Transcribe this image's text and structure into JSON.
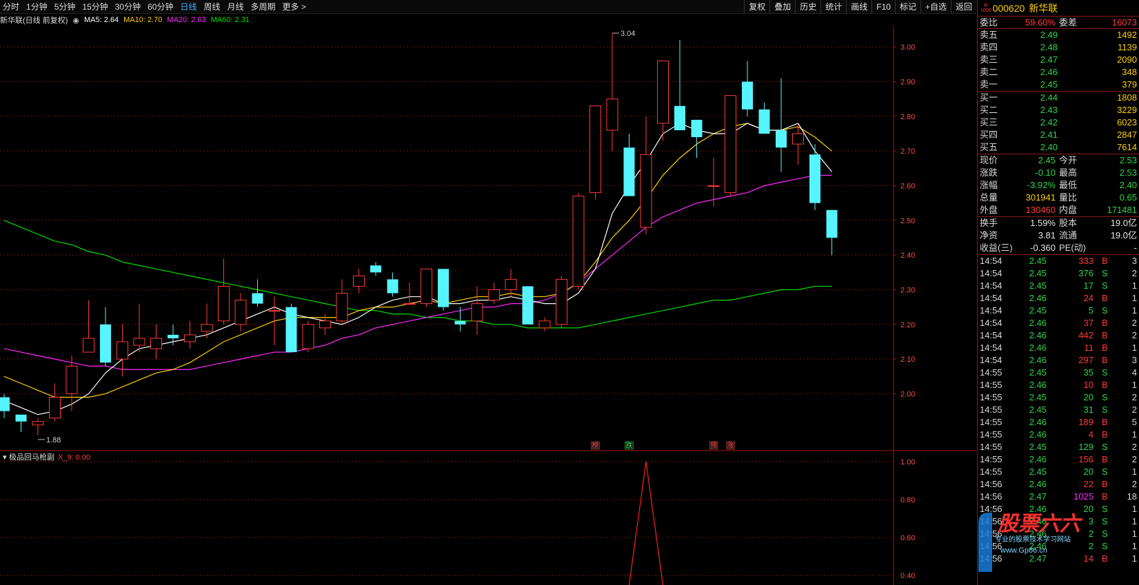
{
  "periods": [
    {
      "label": "分时",
      "active": false
    },
    {
      "label": "1分钟",
      "active": false
    },
    {
      "label": "5分钟",
      "active": false
    },
    {
      "label": "15分钟",
      "active": false
    },
    {
      "label": "30分钟",
      "active": false
    },
    {
      "label": "60分钟",
      "active": false
    },
    {
      "label": "日线",
      "active": true
    },
    {
      "label": "周线",
      "active": false
    },
    {
      "label": "月线",
      "active": false
    },
    {
      "label": "多周期",
      "active": false
    },
    {
      "label": "更多 >",
      "active": false
    }
  ],
  "tools": [
    "复权",
    "叠加",
    "历史",
    "统计",
    "画线",
    "F10",
    "标记",
    "+自选",
    "返回"
  ],
  "info": {
    "title": "新华联(日线 前复权)",
    "ma": [
      {
        "label": "MA5: 2.64",
        "color": "#ffffff"
      },
      {
        "label": "MA10: 2.70",
        "color": "#ffd000"
      },
      {
        "label": "MA20: 2.63",
        "color": "#ff2bff"
      },
      {
        "label": "MA60: 2.31",
        "color": "#00e000"
      }
    ]
  },
  "indicator": {
    "name": "极品回马枪副",
    "value": "X_9: 0.00"
  },
  "colors": {
    "up": "#ff3b3b",
    "down": "#55f4ff",
    "ma5": "#ffffff",
    "ma10": "#ffd000",
    "ma20": "#ff2bff",
    "ma60": "#00e000"
  },
  "chart_data": {
    "type": "candlestick",
    "price_axis": {
      "min": 1.84,
      "max": 3.06,
      "ticks": [
        "3.00",
        "2.90",
        "2.80",
        "2.70",
        "2.60",
        "2.50",
        "2.40",
        "2.30",
        "2.20",
        "2.10",
        "2.00"
      ]
    },
    "annotations": {
      "high": "3.04",
      "low": "1.88"
    },
    "candles": [
      {
        "o": 1.99,
        "c": 1.95,
        "h": 2.0,
        "l": 1.93
      },
      {
        "o": 1.94,
        "c": 1.92,
        "h": 1.94,
        "l": 1.89
      },
      {
        "o": 1.91,
        "c": 1.92,
        "h": 1.93,
        "l": 1.88
      },
      {
        "o": 1.93,
        "c": 1.99,
        "h": 2.03,
        "l": 1.92
      },
      {
        "o": 2.0,
        "c": 2.08,
        "h": 2.11,
        "l": 1.95
      },
      {
        "o": 2.12,
        "c": 2.16,
        "h": 2.27,
        "l": 2.12
      },
      {
        "o": 2.2,
        "c": 2.09,
        "h": 2.25,
        "l": 2.08
      },
      {
        "o": 2.1,
        "c": 2.15,
        "h": 2.2,
        "l": 2.05
      },
      {
        "o": 2.14,
        "c": 2.16,
        "h": 2.26,
        "l": 2.12
      },
      {
        "o": 2.13,
        "c": 2.16,
        "h": 2.2,
        "l": 2.1
      },
      {
        "o": 2.17,
        "c": 2.16,
        "h": 2.2,
        "l": 2.14
      },
      {
        "o": 2.15,
        "c": 2.17,
        "h": 2.21,
        "l": 2.13
      },
      {
        "o": 2.18,
        "c": 2.2,
        "h": 2.26,
        "l": 2.16
      },
      {
        "o": 2.21,
        "c": 2.31,
        "h": 2.39,
        "l": 2.2
      },
      {
        "o": 2.2,
        "c": 2.27,
        "h": 2.29,
        "l": 2.18
      },
      {
        "o": 2.29,
        "c": 2.26,
        "h": 2.33,
        "l": 2.25
      },
      {
        "o": 2.24,
        "c": 2.24,
        "h": 2.28,
        "l": 2.14
      },
      {
        "o": 2.25,
        "c": 2.12,
        "h": 2.26,
        "l": 2.12
      },
      {
        "o": 2.13,
        "c": 2.2,
        "h": 2.21,
        "l": 2.12
      },
      {
        "o": 2.19,
        "c": 2.21,
        "h": 2.23,
        "l": 2.17
      },
      {
        "o": 2.21,
        "c": 2.29,
        "h": 2.33,
        "l": 2.2
      },
      {
        "o": 2.31,
        "c": 2.34,
        "h": 2.36,
        "l": 2.29
      },
      {
        "o": 2.37,
        "c": 2.35,
        "h": 2.38,
        "l": 2.34
      },
      {
        "o": 2.33,
        "c": 2.29,
        "h": 2.35,
        "l": 2.28
      },
      {
        "o": 2.26,
        "c": 2.26,
        "h": 2.32,
        "l": 2.26
      },
      {
        "o": 2.26,
        "c": 2.36,
        "h": 2.36,
        "l": 2.25
      },
      {
        "o": 2.36,
        "c": 2.25,
        "h": 2.36,
        "l": 2.24
      },
      {
        "o": 2.21,
        "c": 2.2,
        "h": 2.25,
        "l": 2.18
      },
      {
        "o": 2.21,
        "c": 2.26,
        "h": 2.31,
        "l": 2.17
      },
      {
        "o": 2.27,
        "c": 2.3,
        "h": 2.32,
        "l": 2.26
      },
      {
        "o": 2.3,
        "c": 2.33,
        "h": 2.36,
        "l": 2.28
      },
      {
        "o": 2.31,
        "c": 2.2,
        "h": 2.31,
        "l": 2.2
      },
      {
        "o": 2.19,
        "c": 2.21,
        "h": 2.22,
        "l": 2.18
      },
      {
        "o": 2.2,
        "c": 2.33,
        "h": 2.34,
        "l": 2.19
      },
      {
        "o": 2.31,
        "c": 2.57,
        "h": 2.58,
        "l": 2.3
      },
      {
        "o": 2.58,
        "c": 2.83,
        "h": 2.83,
        "l": 2.56
      },
      {
        "o": 2.76,
        "c": 2.85,
        "h": 3.04,
        "l": 2.7
      },
      {
        "o": 2.71,
        "c": 2.57,
        "h": 2.75,
        "l": 2.57
      },
      {
        "o": 2.48,
        "c": 2.69,
        "h": 2.8,
        "l": 2.46
      },
      {
        "o": 2.78,
        "c": 2.96,
        "h": 2.96,
        "l": 2.73
      },
      {
        "o": 2.83,
        "c": 2.76,
        "h": 3.02,
        "l": 2.76
      },
      {
        "o": 2.79,
        "c": 2.74,
        "h": 2.79,
        "l": 2.68
      },
      {
        "o": 2.6,
        "c": 2.6,
        "h": 2.68,
        "l": 2.54
      },
      {
        "o": 2.58,
        "c": 2.86,
        "h": 2.86,
        "l": 2.57
      },
      {
        "o": 2.9,
        "c": 2.82,
        "h": 2.96,
        "l": 2.8
      },
      {
        "o": 2.82,
        "c": 2.75,
        "h": 2.84,
        "l": 2.75
      },
      {
        "o": 2.76,
        "c": 2.71,
        "h": 2.91,
        "l": 2.64
      },
      {
        "o": 2.72,
        "c": 2.75,
        "h": 2.78,
        "l": 2.66
      },
      {
        "o": 2.69,
        "c": 2.55,
        "h": 2.72,
        "l": 2.53
      },
      {
        "o": 2.53,
        "c": 2.45,
        "h": 2.53,
        "l": 2.4
      }
    ],
    "ma5": [
      1.98,
      1.96,
      1.94,
      1.95,
      1.97,
      2.0,
      2.06,
      2.1,
      2.13,
      2.14,
      2.15,
      2.16,
      2.17,
      2.19,
      2.21,
      2.23,
      2.25,
      2.23,
      2.22,
      2.21,
      2.2,
      2.22,
      2.25,
      2.27,
      2.28,
      2.28,
      2.26,
      2.26,
      2.27,
      2.27,
      2.28,
      2.27,
      2.26,
      2.26,
      2.29,
      2.36,
      2.52,
      2.6,
      2.67,
      2.75,
      2.78,
      2.76,
      2.75,
      2.75,
      2.78,
      2.76,
      2.76,
      2.78,
      2.7,
      2.64
    ],
    "ma10": [
      2.05,
      2.03,
      2.01,
      1.99,
      1.99,
      1.99,
      2.0,
      2.02,
      2.04,
      2.06,
      2.07,
      2.09,
      2.12,
      2.15,
      2.17,
      2.19,
      2.21,
      2.22,
      2.22,
      2.22,
      2.22,
      2.24,
      2.25,
      2.25,
      2.26,
      2.27,
      2.26,
      2.27,
      2.28,
      2.28,
      2.29,
      2.28,
      2.28,
      2.29,
      2.32,
      2.38,
      2.45,
      2.5,
      2.56,
      2.63,
      2.68,
      2.72,
      2.75,
      2.77,
      2.78,
      2.76,
      2.76,
      2.77,
      2.74,
      2.7
    ],
    "ma20": [
      2.13,
      2.12,
      2.11,
      2.1,
      2.09,
      2.08,
      2.08,
      2.07,
      2.07,
      2.07,
      2.07,
      2.07,
      2.08,
      2.09,
      2.1,
      2.11,
      2.12,
      2.12,
      2.13,
      2.14,
      2.16,
      2.17,
      2.19,
      2.2,
      2.21,
      2.22,
      2.23,
      2.24,
      2.25,
      2.25,
      2.26,
      2.26,
      2.27,
      2.29,
      2.32,
      2.36,
      2.4,
      2.44,
      2.48,
      2.51,
      2.53,
      2.55,
      2.56,
      2.57,
      2.58,
      2.6,
      2.61,
      2.62,
      2.63,
      2.63
    ],
    "ma60": [
      2.5,
      2.48,
      2.46,
      2.44,
      2.43,
      2.41,
      2.4,
      2.38,
      2.37,
      2.36,
      2.35,
      2.34,
      2.33,
      2.32,
      2.31,
      2.3,
      2.29,
      2.28,
      2.27,
      2.26,
      2.25,
      2.24,
      2.24,
      2.23,
      2.23,
      2.22,
      2.22,
      2.21,
      2.21,
      2.2,
      2.2,
      2.19,
      2.19,
      2.19,
      2.19,
      2.2,
      2.21,
      2.22,
      2.23,
      2.24,
      2.25,
      2.26,
      2.27,
      2.27,
      2.28,
      2.29,
      2.3,
      2.3,
      2.31,
      2.31
    ],
    "markers": [
      {
        "index": 35,
        "label": "榜",
        "color": "#ff3b3b"
      },
      {
        "index": 37,
        "label": "跌",
        "color": "#2ed64a"
      },
      {
        "index": 42,
        "label": "预",
        "color": "#ff3b3b"
      },
      {
        "index": 43,
        "label": "涨",
        "color": "#ff3b3b"
      }
    ],
    "sub": {
      "min": 0.35,
      "max": 1.05,
      "ticks": [
        "1.00",
        "0.80",
        "0.60",
        "0.40"
      ],
      "spike_index": 38,
      "spike_value": 1.0
    }
  },
  "quote": {
    "code": "000620",
    "name": "新华联",
    "weibi": {
      "label": "委比",
      "value": "59.60%",
      "label2": "委差",
      "value2": "16073"
    },
    "asks": [
      {
        "label": "卖五",
        "price": "2.49",
        "vol": "1492"
      },
      {
        "label": "卖四",
        "price": "2.48",
        "vol": "1139"
      },
      {
        "label": "卖三",
        "price": "2.47",
        "vol": "2090"
      },
      {
        "label": "卖二",
        "price": "2.46",
        "vol": "348"
      },
      {
        "label": "卖一",
        "price": "2.45",
        "vol": "379"
      }
    ],
    "bids": [
      {
        "label": "买一",
        "price": "2.44",
        "vol": "1808"
      },
      {
        "label": "买二",
        "price": "2.43",
        "vol": "3229"
      },
      {
        "label": "买三",
        "price": "2.42",
        "vol": "6023"
      },
      {
        "label": "买四",
        "price": "2.41",
        "vol": "2847"
      },
      {
        "label": "买五",
        "price": "2.40",
        "vol": "7614"
      }
    ],
    "stats1": [
      {
        "l1": "现价",
        "v1": "2.45",
        "c1": "green",
        "l2": "今开",
        "v2": "2.53",
        "c2": "green"
      },
      {
        "l1": "涨跌",
        "v1": "-0.10",
        "c1": "green",
        "l2": "最高",
        "v2": "2.53",
        "c2": "green"
      },
      {
        "l1": "涨幅",
        "v1": "-3.92%",
        "c1": "green",
        "l2": "最低",
        "v2": "2.40",
        "c2": "green"
      },
      {
        "l1": "总量",
        "v1": "301941",
        "c1": "yel",
        "l2": "量比",
        "v2": "0.65",
        "c2": "green"
      },
      {
        "l1": "外盘",
        "v1": "130460",
        "c1": "red",
        "l2": "内盘",
        "v2": "171481",
        "c2": "green"
      }
    ],
    "stats2": [
      {
        "l1": "换手",
        "v1": "1.59%",
        "c1": "wht",
        "l2": "股本",
        "v2": "19.0亿",
        "c2": "wht"
      },
      {
        "l1": "净资",
        "v1": "3.81",
        "c1": "wht",
        "l2": "流通",
        "v2": "19.0亿",
        "c2": "wht"
      },
      {
        "l1": "收益(三)",
        "v1": "-0.360",
        "c1": "wht",
        "l2": "PE(动)",
        "v2": "-",
        "c2": "wht"
      }
    ],
    "ticks": [
      {
        "t": "14:54",
        "p": "2.45",
        "v": "333",
        "s": "B",
        "n": "3"
      },
      {
        "t": "14:54",
        "p": "2.45",
        "v": "376",
        "s": "S",
        "n": "2"
      },
      {
        "t": "14:54",
        "p": "2.45",
        "v": "17",
        "s": "S",
        "n": "1"
      },
      {
        "t": "14:54",
        "p": "2.46",
        "v": "24",
        "s": "B",
        "n": "1"
      },
      {
        "t": "14:54",
        "p": "2.45",
        "v": "5",
        "s": "S",
        "n": "1"
      },
      {
        "t": "14:54",
        "p": "2.46",
        "v": "37",
        "s": "B",
        "n": "2"
      },
      {
        "t": "14:54",
        "p": "2.46",
        "v": "442",
        "s": "B",
        "n": "2"
      },
      {
        "t": "14:54",
        "p": "2.46",
        "v": "11",
        "s": "B",
        "n": "1"
      },
      {
        "t": "14:54",
        "p": "2.46",
        "v": "297",
        "s": "B",
        "n": "3"
      },
      {
        "t": "14:55",
        "p": "2.45",
        "v": "35",
        "s": "S",
        "n": "4"
      },
      {
        "t": "14:55",
        "p": "2.46",
        "v": "10",
        "s": "B",
        "n": "1"
      },
      {
        "t": "14:55",
        "p": "2.45",
        "v": "20",
        "s": "S",
        "n": "2"
      },
      {
        "t": "14:55",
        "p": "2.45",
        "v": "31",
        "s": "S",
        "n": "2"
      },
      {
        "t": "14:55",
        "p": "2.46",
        "v": "189",
        "s": "B",
        "n": "5"
      },
      {
        "t": "14:55",
        "p": "2.46",
        "v": "4",
        "s": "B",
        "n": "1"
      },
      {
        "t": "14:55",
        "p": "2.45",
        "v": "129",
        "s": "S",
        "n": "2"
      },
      {
        "t": "14:55",
        "p": "2.46",
        "v": "156",
        "s": "B",
        "n": "2"
      },
      {
        "t": "14:55",
        "p": "2.45",
        "v": "20",
        "s": "S",
        "n": "1"
      },
      {
        "t": "14:56",
        "p": "2.46",
        "v": "22",
        "s": "B",
        "n": "2"
      },
      {
        "t": "14:56",
        "p": "2.47",
        "v": "1025",
        "s": "B",
        "n": "18"
      },
      {
        "t": "14:56",
        "p": "2.46",
        "v": "20",
        "s": "S",
        "n": "1"
      },
      {
        "t": "14:56",
        "p": "2.46",
        "v": "3",
        "s": "S",
        "n": "1"
      },
      {
        "t": "14:56",
        "p": "2.46",
        "v": "2",
        "s": "S",
        "n": "1"
      },
      {
        "t": "14:56",
        "p": "2.46",
        "v": "2",
        "s": "S",
        "n": "1"
      },
      {
        "t": "14:56",
        "p": "2.47",
        "v": "14",
        "s": "B",
        "n": "1"
      }
    ]
  },
  "watermark": {
    "title": "股票六六",
    "subtitle": "专业的股票技术学习网站",
    "url": "www.Gp66.cn"
  }
}
